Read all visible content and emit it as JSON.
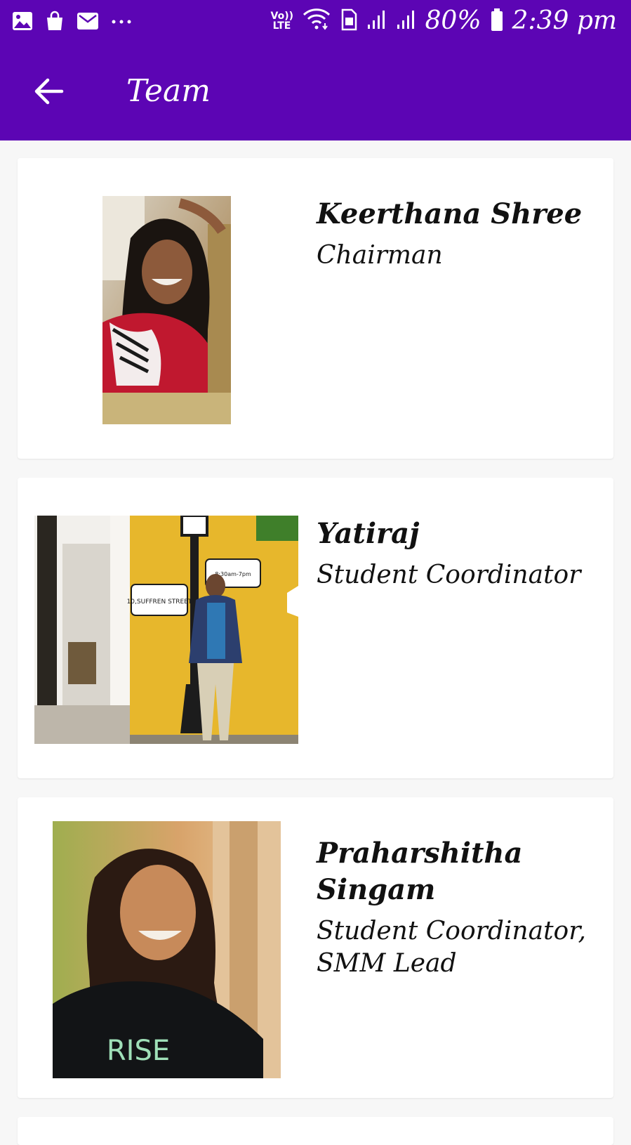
{
  "status_bar": {
    "icons": [
      "gallery-icon",
      "shopping-bag-icon",
      "mail-icon",
      "more-dots-icon"
    ],
    "network_label": "Vo)) LTE",
    "battery": "80%",
    "time": "2:39 pm"
  },
  "toolbar": {
    "title": "Team",
    "back_icon": "arrow-left-icon"
  },
  "colors": {
    "app_bar": "#5c05b4",
    "background": "#f7f7f7",
    "card": "#ffffff",
    "text": "#111111"
  },
  "team": [
    {
      "name": "Keerthana Shree",
      "role": "Chairman"
    },
    {
      "name": "Yatiraj",
      "role": "Student Coordinator",
      "photo_sign_texts": [
        "10,SUFFREN STREET",
        "8:30am-7pm"
      ]
    },
    {
      "name": "Praharshitha Singam",
      "role": "Student Coordinator, SMM Lead",
      "shirt_text": "RISE"
    }
  ]
}
